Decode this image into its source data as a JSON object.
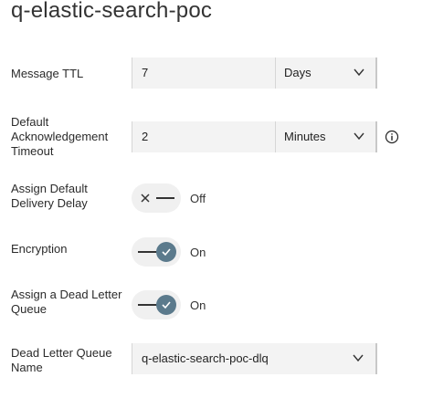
{
  "page": {
    "title": "q-elastic-search-poc"
  },
  "message_ttl": {
    "label": "Message TTL",
    "value": "7",
    "unit": "Days"
  },
  "ack_timeout": {
    "label": "Default Acknowledgement Timeout",
    "value": "2",
    "unit": "Minutes"
  },
  "delivery_delay": {
    "label": "Assign Default Delivery Delay",
    "state": "Off"
  },
  "encryption": {
    "label": "Encryption",
    "state": "On"
  },
  "dead_letter": {
    "label": "Assign a Dead Letter Queue",
    "state": "On"
  },
  "dlq_name": {
    "label": "Dead Letter Queue Name",
    "value": "q-elastic-search-poc-dlq"
  },
  "icons": {
    "dropdown": "chevron-down-icon",
    "info": "info-icon",
    "toggle_on": "checkmark-icon",
    "toggle_off": "close-icon"
  },
  "colors": {
    "toggle_on": "#5b7a8c",
    "field_bg": "#f3f3f3"
  }
}
